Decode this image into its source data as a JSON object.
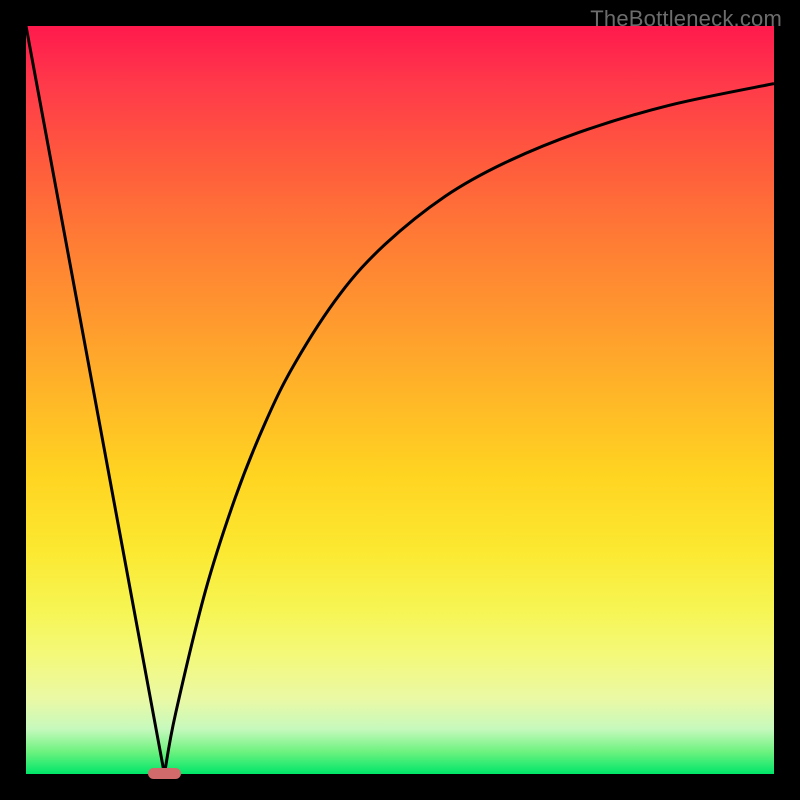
{
  "watermark": "TheBottleneck.com",
  "chart_data": {
    "type": "line",
    "title": "",
    "xlabel": "",
    "ylabel": "",
    "xlim": [
      0,
      100
    ],
    "ylim": [
      0,
      100
    ],
    "grid": false,
    "legend": false,
    "series": [
      {
        "name": "left-branch",
        "x": [
          0,
          4,
          8,
          12,
          16,
          18.5
        ],
        "values": [
          100,
          78.4,
          56.8,
          35.1,
          13.5,
          0
        ]
      },
      {
        "name": "right-branch",
        "x": [
          18.5,
          20,
          24,
          28,
          32,
          36,
          42,
          48,
          56,
          64,
          74,
          86,
          100
        ],
        "values": [
          0,
          8.1,
          24.5,
          37.0,
          47.0,
          55.0,
          64.2,
          70.8,
          77.2,
          81.7,
          85.8,
          89.4,
          92.3
        ]
      }
    ],
    "marker": {
      "x_center": 18.5,
      "width_pct": 4.5
    },
    "gradient_stops": [
      {
        "pos": 0,
        "color": "#ff1a4d"
      },
      {
        "pos": 50,
        "color": "#ffb827"
      },
      {
        "pos": 78,
        "color": "#f6f553"
      },
      {
        "pos": 100,
        "color": "#00e66a"
      }
    ]
  }
}
